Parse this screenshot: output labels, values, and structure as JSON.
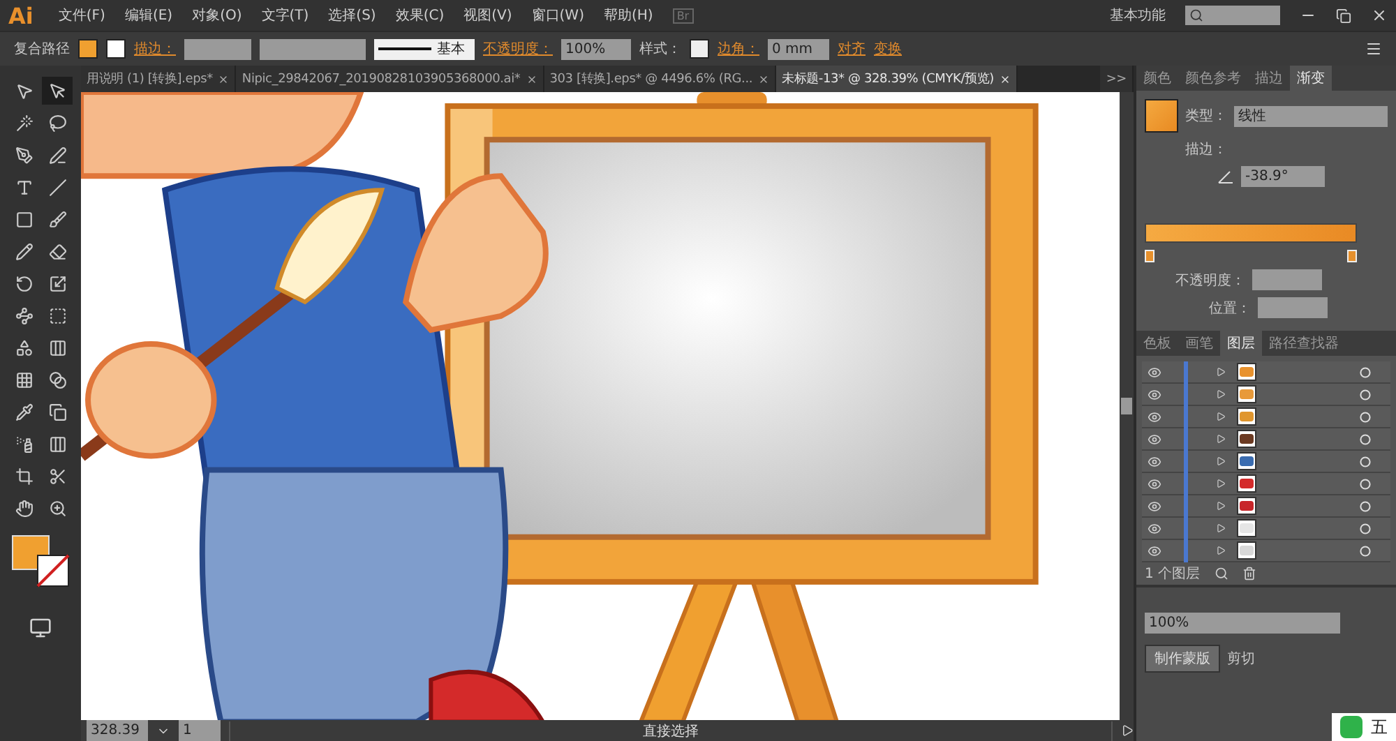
{
  "app_logo": "Ai",
  "menu": [
    "文件(F)",
    "编辑(E)",
    "对象(O)",
    "文字(T)",
    "选择(S)",
    "效果(C)",
    "视图(V)",
    "窗口(W)",
    "帮助(H)"
  ],
  "bridge_label": "Br",
  "workspace": "基本功能",
  "control_bar": {
    "selection": "复合路径",
    "stroke_label": "描边：",
    "stroke_profile": "基本",
    "opacity_label": "不透明度：",
    "opacity": "100%",
    "style_label": "样式：",
    "corner_label": "边角：",
    "corner": "0 mm",
    "align_link": "对齐",
    "transform_link": "变换"
  },
  "tabs": [
    {
      "label": "用说明 (1) [转换].eps*",
      "selected": false
    },
    {
      "label": "Nipic_29842067_20190828103905368000.ai*",
      "selected": false
    },
    {
      "label": "303 [转换].eps* @ 4496.6% (RG...",
      "selected": false
    },
    {
      "label": "未标题-13* @ 328.39% (CMYK/预览)",
      "selected": true
    }
  ],
  "tabs_more": ">>",
  "tools": [
    {
      "selected": false
    },
    {
      "selected": true
    },
    {
      "selected": false
    },
    {
      "selected": false
    },
    {
      "selected": false
    },
    {
      "selected": false
    },
    {
      "selected": false
    },
    {
      "selected": false
    },
    {
      "selected": false
    },
    {
      "selected": false
    },
    {
      "selected": false
    },
    {
      "selected": false
    },
    {
      "selected": false
    },
    {
      "selected": false
    },
    {
      "selected": false
    },
    {
      "selected": false
    },
    {
      "selected": false
    },
    {
      "selected": false
    },
    {
      "selected": false
    },
    {
      "selected": false
    },
    {
      "selected": false
    },
    {
      "selected": false
    },
    {
      "selected": false
    },
    {
      "selected": false
    },
    {
      "selected": false
    },
    {
      "selected": false
    },
    {
      "selected": false
    },
    {
      "selected": false
    }
  ],
  "gradient_panel": {
    "tabs": [
      {
        "label": "颜色",
        "selected": false
      },
      {
        "label": "颜色参考",
        "selected": false
      },
      {
        "label": "描边",
        "selected": false
      },
      {
        "label": "渐变",
        "selected": true
      }
    ],
    "type_label": "类型：",
    "type": "线性",
    "stroke_label": "描边：",
    "angle": "-38.9°",
    "opacity_label": "不透明度：",
    "location_label": "位置："
  },
  "layers_panel": {
    "tabs": [
      {
        "label": "色板",
        "selected": false
      },
      {
        "label": "画笔",
        "selected": false
      },
      {
        "label": "图层",
        "selected": true
      },
      {
        "label": "路径查找器",
        "selected": false
      }
    ],
    "rows": [
      {
        "color": "#e8922e"
      },
      {
        "color": "#e89a3a"
      },
      {
        "color": "#e0962e"
      },
      {
        "color": "#6b3a22"
      },
      {
        "color": "#3a6cb0"
      },
      {
        "color": "#d42a2a"
      },
      {
        "color": "#c8262a"
      },
      {
        "color": "#e6e6e6"
      },
      {
        "color": "#d8d8d8"
      }
    ],
    "count": "1 个图层"
  },
  "transparency_panel": {
    "opacity": "100%",
    "mask_button": "制作蒙版",
    "clip_label": "剪切"
  },
  "status_bar": {
    "zoom": "328.39",
    "page": "1",
    "tool": "直接选择"
  },
  "ime_bar": {
    "mode": "五"
  }
}
